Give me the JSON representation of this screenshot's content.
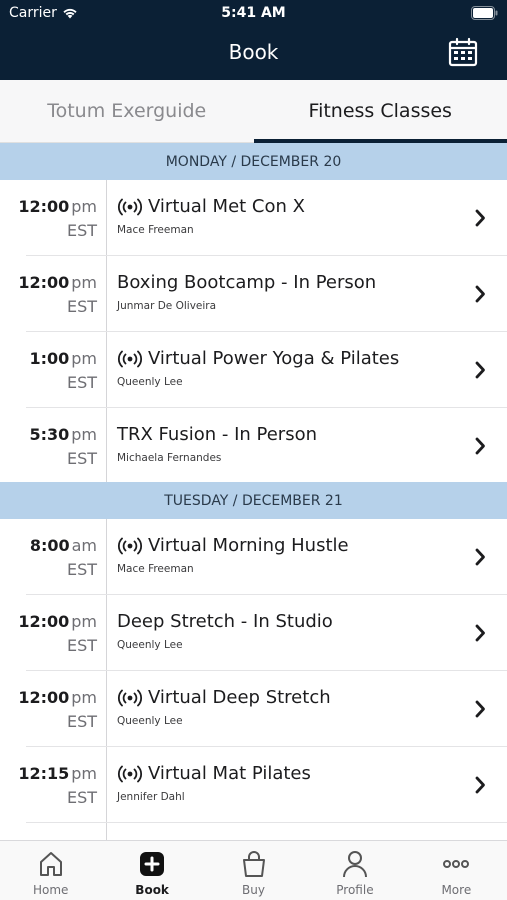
{
  "status_bar": {
    "carrier": "Carrier",
    "time": "5:41 AM"
  },
  "nav": {
    "title": "Book"
  },
  "tabs": [
    {
      "label": "Totum Exerguide",
      "active": false
    },
    {
      "label": "Fitness Classes",
      "active": true
    }
  ],
  "days": [
    {
      "label": "MONDAY / DECEMBER 20",
      "classes": [
        {
          "time": "12:00",
          "ampm": "pm",
          "tz": "EST",
          "title": "Virtual Met Con X",
          "instructor": "Mace Freeman",
          "virtual": true
        },
        {
          "time": "12:00",
          "ampm": "pm",
          "tz": "EST",
          "title": "Boxing Bootcamp - In Person",
          "instructor": "Junmar De Oliveira",
          "virtual": false
        },
        {
          "time": "1:00",
          "ampm": "pm",
          "tz": "EST",
          "title": "Virtual Power Yoga & Pilates",
          "instructor": "Queenly Lee",
          "virtual": true
        },
        {
          "time": "5:30",
          "ampm": "pm",
          "tz": "EST",
          "title": "TRX Fusion - In Person",
          "instructor": "Michaela Fernandes",
          "virtual": false
        }
      ]
    },
    {
      "label": "TUESDAY / DECEMBER 21",
      "classes": [
        {
          "time": "8:00",
          "ampm": "am",
          "tz": "EST",
          "title": "Virtual Morning Hustle",
          "instructor": "Mace Freeman",
          "virtual": true
        },
        {
          "time": "12:00",
          "ampm": "pm",
          "tz": "EST",
          "title": "Deep Stretch - In Studio",
          "instructor": "Queenly Lee",
          "virtual": false
        },
        {
          "time": "12:00",
          "ampm": "pm",
          "tz": "EST",
          "title": "Virtual Deep Stretch",
          "instructor": "Queenly Lee",
          "virtual": true
        },
        {
          "time": "12:15",
          "ampm": "pm",
          "tz": "EST",
          "title": "Virtual Mat Pilates",
          "instructor": "Jennifer Dahl",
          "virtual": true
        }
      ]
    }
  ],
  "tab_bar": [
    {
      "label": "Home",
      "icon": "home-icon",
      "active": false
    },
    {
      "label": "Book",
      "icon": "plus-square-icon",
      "active": true
    },
    {
      "label": "Buy",
      "icon": "shopping-bag-icon",
      "active": false
    },
    {
      "label": "Profile",
      "icon": "person-icon",
      "active": false
    },
    {
      "label": "More",
      "icon": "more-dots-icon",
      "active": false
    }
  ],
  "colors": {
    "header_bg": "#0b2035",
    "day_header_bg": "#b6d1ea",
    "tab_indicator": "#0b2035"
  }
}
